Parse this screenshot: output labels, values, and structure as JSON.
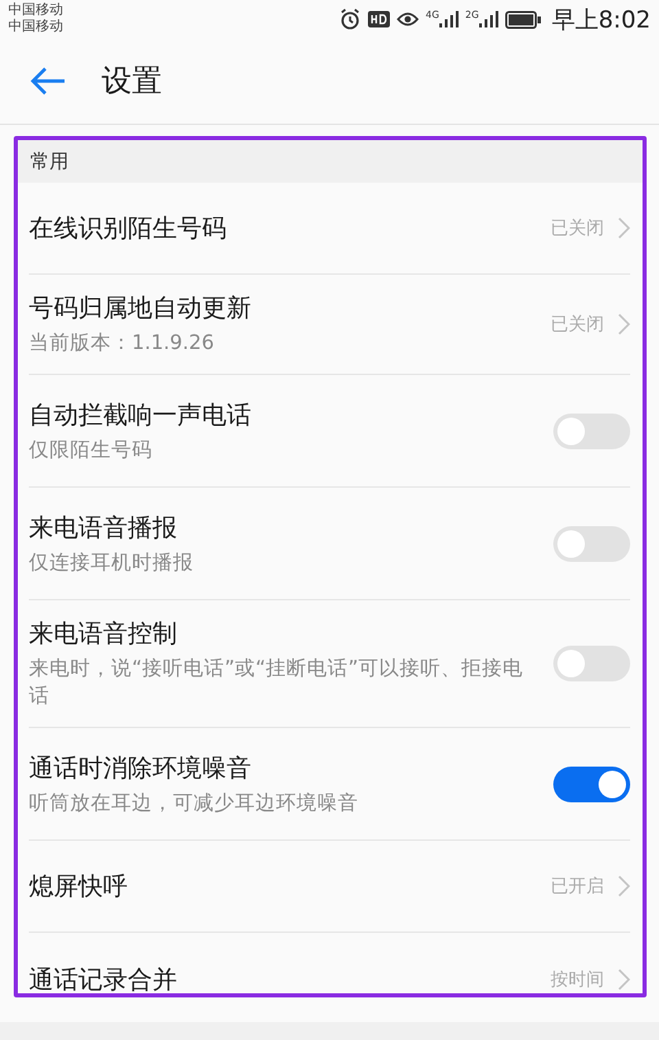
{
  "status_bar": {
    "carriers": [
      "中国移动",
      "中国移动"
    ],
    "network_labels": [
      "4G",
      "2G"
    ],
    "time": "早上8:02"
  },
  "header": {
    "title": "设置"
  },
  "section": {
    "title": "常用",
    "highlighted": true
  },
  "items": [
    {
      "kind": "link",
      "title": "在线识别陌生号码",
      "value": "已关闭"
    },
    {
      "kind": "link",
      "title": "号码归属地自动更新",
      "subtitle": "当前版本：1.1.9.26",
      "value": "已关闭"
    },
    {
      "kind": "toggle",
      "title": "自动拦截响一声电话",
      "subtitle": "仅限陌生号码",
      "on": false
    },
    {
      "kind": "toggle",
      "title": "来电语音播报",
      "subtitle": "仅连接耳机时播报",
      "on": false
    },
    {
      "kind": "toggle",
      "title": "来电语音控制",
      "subtitle": "来电时，说“接听电话”或“挂断电话”可以接听、拒接电话",
      "on": false
    },
    {
      "kind": "toggle",
      "title": "通话时消除环境噪音",
      "subtitle": "听筒放在耳边，可减少耳边环境噪音",
      "on": true
    },
    {
      "kind": "link",
      "title": "熄屏快呼",
      "value": "已开启"
    },
    {
      "kind": "link",
      "title": "通话记录合并",
      "value": "按时间"
    }
  ]
}
